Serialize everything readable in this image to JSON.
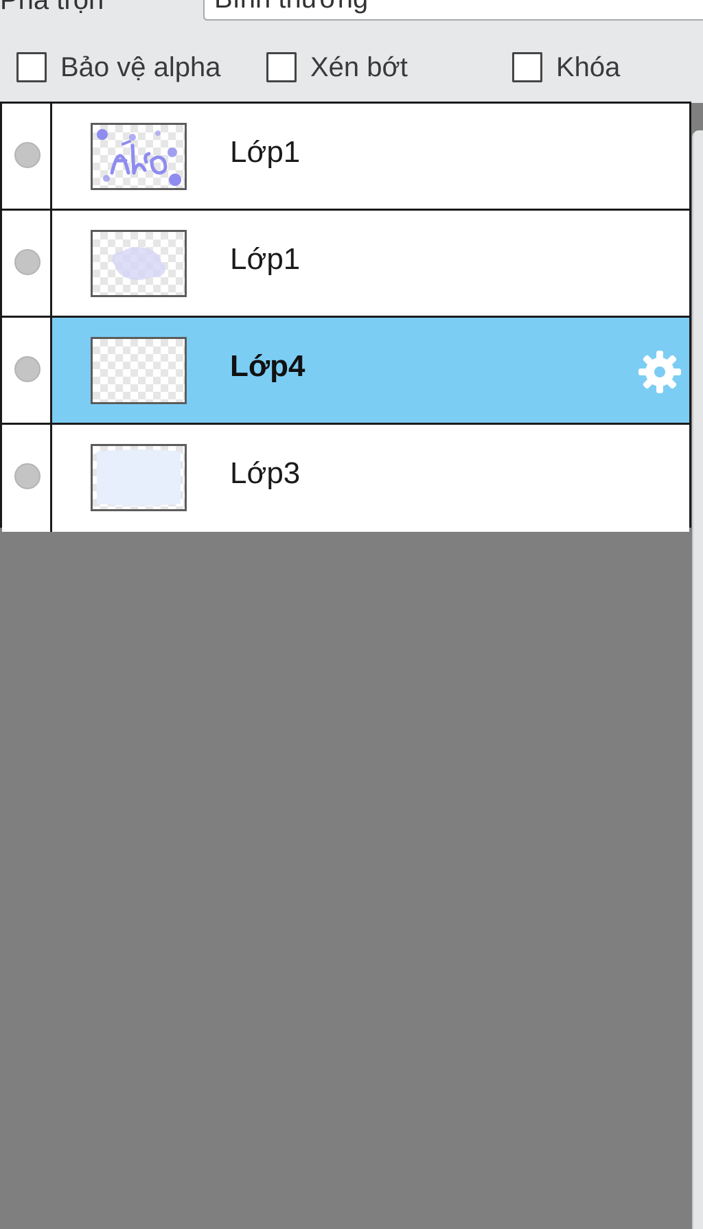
{
  "blend": {
    "label": "Pha trộn",
    "value": "Bình thường"
  },
  "options": {
    "alpha": "Bảo vệ alpha",
    "clip": "Xén bớt",
    "lock": "Khóa"
  },
  "layers": [
    {
      "name": "Lớp1",
      "selected": false
    },
    {
      "name": "Lớp1",
      "selected": false
    },
    {
      "name": "Lớp4",
      "selected": true
    },
    {
      "name": "Lớp3",
      "selected": false
    }
  ],
  "colors": {
    "selected_row": "#7ccdf4",
    "panel_background": "#7f7f7f",
    "toolbar_background": "#e6e8ea",
    "thumbnail_art": "#8f8cf0"
  },
  "icons": {
    "visibility": "visibility-dot-icon",
    "settings": "gear-icon",
    "checkbox": "checkbox-icon"
  }
}
